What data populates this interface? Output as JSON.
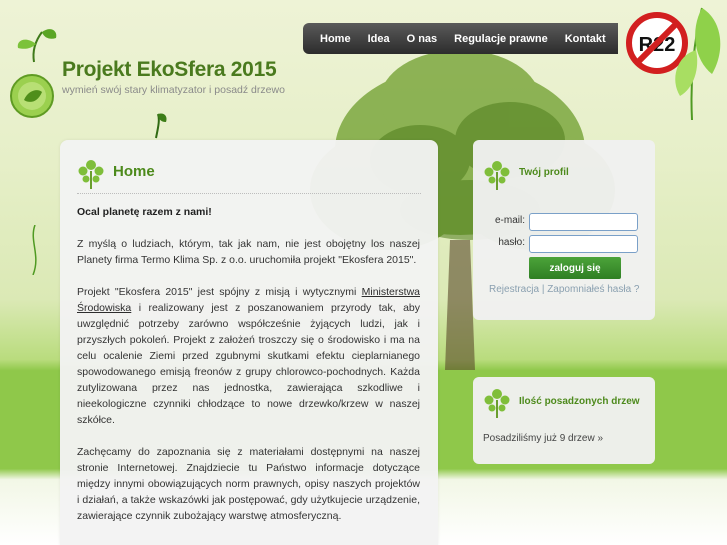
{
  "header": {
    "title": "Projekt EkoSfera 2015",
    "subtitle": "wymień swój stary klimatyzator i posadź drzewo",
    "badge_text": "R22"
  },
  "nav": {
    "items": [
      {
        "label": "Home"
      },
      {
        "label": "Idea"
      },
      {
        "label": "O nas"
      },
      {
        "label": "Regulacje prawne"
      },
      {
        "label": "Kontakt"
      }
    ]
  },
  "main": {
    "title": "Home",
    "lead": "Ocal planetę razem z nami!",
    "p1": "Z myślą o ludziach, którym, tak jak nam, nie jest obojętny los naszej Planety firma Termo Klima Sp. z o.o. uruchomiła projekt \"Ekosfera 2015\".",
    "p2_before": "Projekt \"Ekosfera 2015\" jest spójny z misją i wytycznymi ",
    "p2_link": "Ministerstwa Środowiska",
    "p2_after": " i realizowany jest z poszanowaniem przyrody tak, aby uwzględnić potrzeby zarówno współcześnie żyjących ludzi, jak i przyszłych pokoleń. Projekt z założeń troszczy się o środowisko i ma na celu ocalenie Ziemi przed zgubnymi skutkami efektu cieplarnianego spowodowanego emisją freonów z grupy chlorowco-pochodnych. Każda zutylizowana przez nas jednostka, zawierająca szkodliwe i nieekologiczne czynniki chłodzące to nowe drzewko/krzew w naszej szkółce.",
    "p3": "Zachęcamy do zapoznania się z materiałami dostępnymi na naszej stronie Internetowej. Znajdziecie tu Państwo informacje dotyczące między innymi obowiązujących norm prawnych, opisy naszych projektów i działań, a także wskazówki jak postępować, gdy użytkujecie urządzenie, zawierające czynnik zubożający warstwę atmosferyczną."
  },
  "profile": {
    "title": "Twój profil",
    "email_label": "e-mail:",
    "email_value": "",
    "password_label": "hasło:",
    "password_value": "",
    "login_label": "zaloguj się",
    "register_link": "Rejestracja",
    "separator": "|",
    "forgot_link": "Zapomniałeś hasła ?"
  },
  "trees": {
    "title": "Ilość posadzonych drzew",
    "text": "Posadziliśmy już 9 drzew »"
  },
  "colors": {
    "accent_green": "#4d8a1c",
    "nav_dark": "#2c2c2c",
    "button_green": "#3a8f2c"
  }
}
